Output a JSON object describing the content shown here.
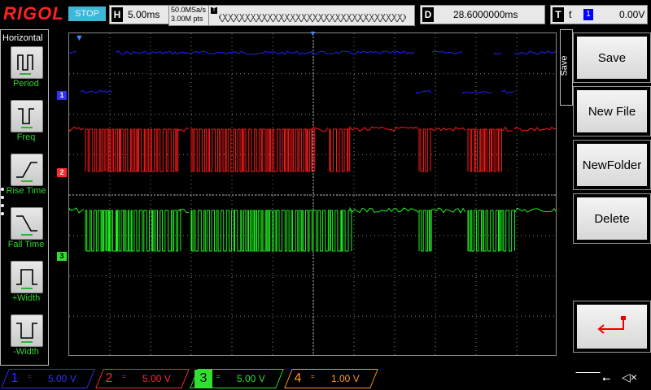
{
  "topbar": {
    "brand": "RIGOL",
    "run_state": "STOP",
    "horizontal_label": "H",
    "timebase": "5.00ms",
    "sample_rate": "50.0MSa/s",
    "memory_depth": "3.00M pts",
    "delay_label": "D",
    "delay_value": "28.6000000ms",
    "trigger_label": "T",
    "trigger_source": "1",
    "trigger_level": "0.00V"
  },
  "left_menu": {
    "title": "Horizontal",
    "items": [
      {
        "label": "Period",
        "icon": "period-icon"
      },
      {
        "label": "Freq",
        "icon": "freq-icon"
      },
      {
        "label": "Rise Time",
        "icon": "rise-time-icon"
      },
      {
        "label": "Fall Time",
        "icon": "fall-time-icon"
      },
      {
        "label": "+Width",
        "icon": "positive-width-icon"
      },
      {
        "label": "-Width",
        "icon": "negative-width-icon"
      }
    ]
  },
  "right_menu": {
    "tab": "Save",
    "buttons": [
      {
        "label": "Save"
      },
      {
        "label": "New File"
      },
      {
        "label": "NewFolder"
      },
      {
        "label": "Delete"
      },
      {
        "label": "",
        "icon": "return-arrow-icon"
      }
    ]
  },
  "channels": [
    {
      "num": "1",
      "coupling": "=",
      "scale": "5.00 V",
      "color": "#3030ff",
      "marker": "1"
    },
    {
      "num": "2",
      "coupling": "=",
      "scale": "5.00 V",
      "color": "#ff2a2a",
      "marker": "2"
    },
    {
      "num": "3",
      "coupling": "=",
      "scale": "5.00 V",
      "color": "#2fe02f",
      "marker": "3"
    },
    {
      "num": "4",
      "coupling": "=",
      "scale": "1.00 V",
      "color": "#ff9a20",
      "marker": "4"
    }
  ],
  "status_icons": [
    "usb-icon",
    "speaker-icon"
  ],
  "colors": {
    "grid": "#808080",
    "ch1": "#2020ff",
    "ch2": "#ff1a1a",
    "ch3": "#20f020",
    "active_label": "#2fd42f",
    "stop_badge": "#3fb7d8"
  }
}
